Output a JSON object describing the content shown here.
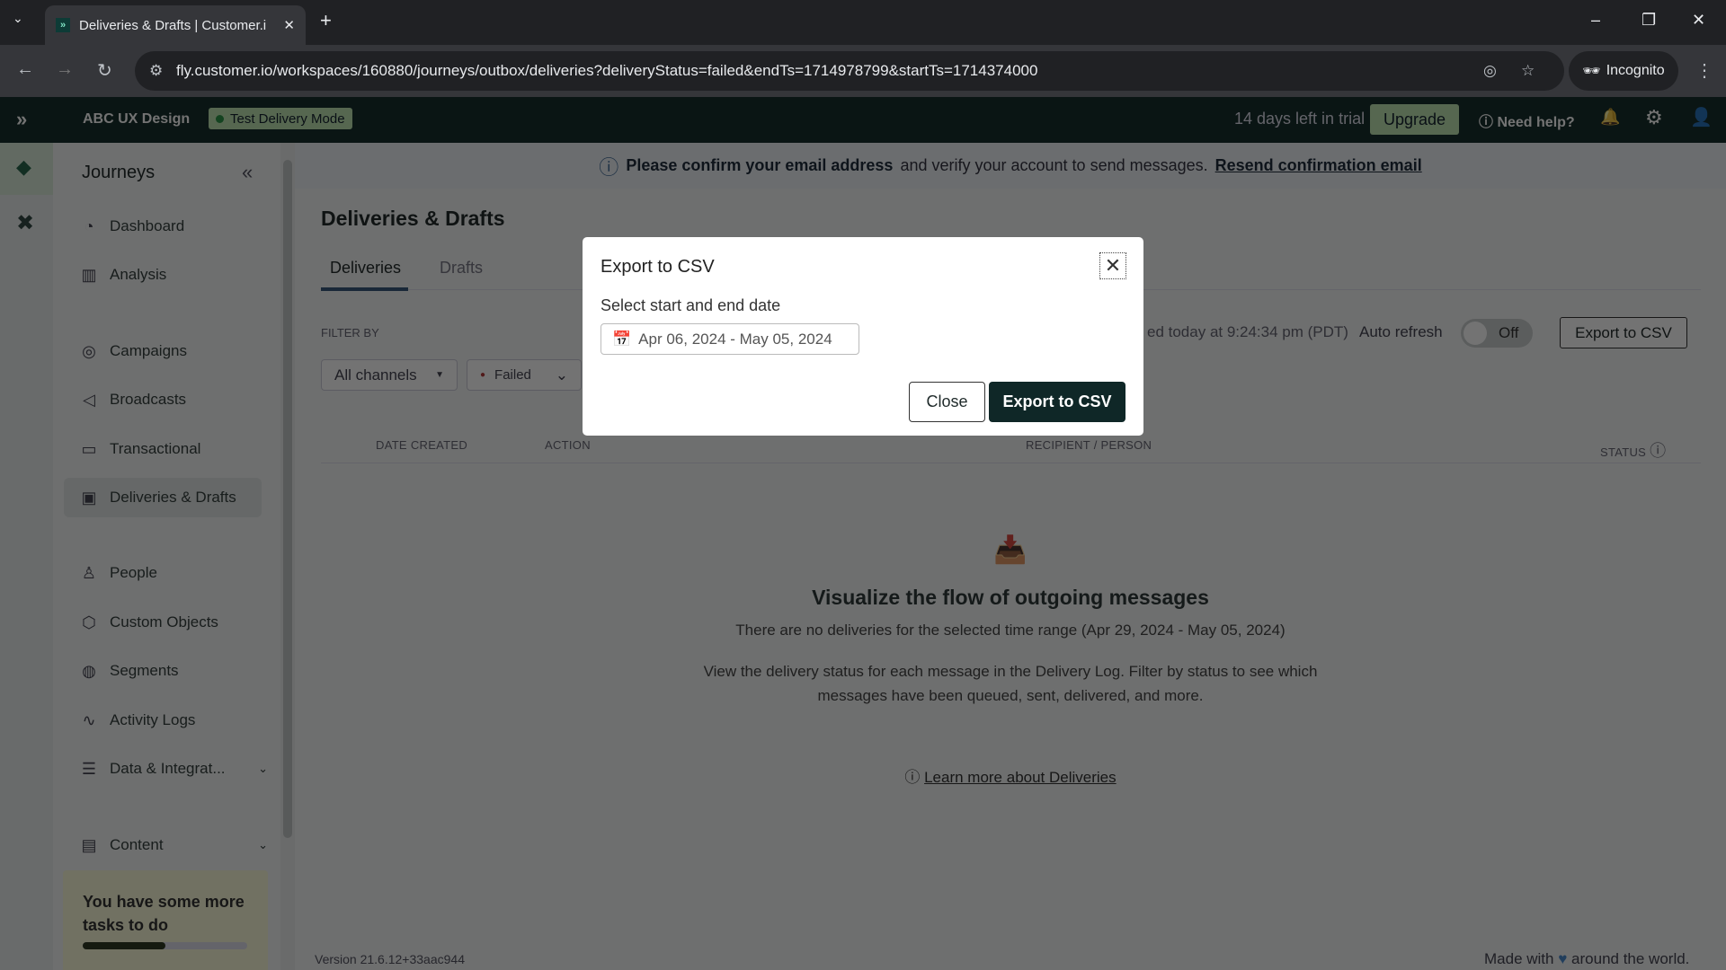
{
  "browser": {
    "tab_title": "Deliveries & Drafts | Customer.i",
    "url": "fly.customer.io/workspaces/160880/journeys/outbox/deliveries?deliveryStatus=failed&endTs=1714978799&startTs=1714374000",
    "incognito": "Incognito"
  },
  "header": {
    "workspace": "ABC UX Design",
    "mode_badge": "Test Delivery Mode",
    "trial": "14 days left in trial",
    "upgrade": "Upgrade",
    "help": "Need help?"
  },
  "sidebar": {
    "title": "Journeys",
    "items": [
      {
        "label": "Dashboard"
      },
      {
        "label": "Analysis"
      },
      {
        "label": "Campaigns"
      },
      {
        "label": "Broadcasts"
      },
      {
        "label": "Transactional"
      },
      {
        "label": "Deliveries & Drafts"
      },
      {
        "label": "People"
      },
      {
        "label": "Custom Objects"
      },
      {
        "label": "Segments"
      },
      {
        "label": "Activity Logs"
      },
      {
        "label": "Data & Integrat..."
      },
      {
        "label": "Content"
      }
    ],
    "tasks": {
      "title": "You have some more tasks to do",
      "progress": 0.5
    }
  },
  "banner": {
    "bold": "Please confirm your email address",
    "text": "and verify your account to send messages.",
    "link": "Resend confirmation email"
  },
  "main": {
    "title": "Deliveries & Drafts",
    "tabs": [
      {
        "label": "Deliveries"
      },
      {
        "label": "Drafts"
      }
    ],
    "filter_by": "FILTER BY",
    "channel_filter": "All channels",
    "status_filter": "Failed",
    "updated": "ed today at 9:24:34 pm (PDT)",
    "auto_refresh": "Auto refresh",
    "toggle": "Off",
    "export": "Export to CSV",
    "columns": [
      "DATE CREATED",
      "ACTION",
      "RECIPIENT / PERSON",
      "STATUS"
    ],
    "empty": {
      "title": "Visualize the flow of outgoing messages",
      "subtitle": "There are no deliveries for the selected time range (Apr 29, 2024 - May 05, 2024)",
      "para1": "View the delivery status for each message in the Delivery Log. Filter by status to see which",
      "para2": "messages have been queued, sent, delivered, and more.",
      "link": "Learn more about Deliveries"
    },
    "version": "Version 21.6.12+33aac944",
    "footer": "Made with",
    "footer2": "around the world."
  },
  "modal": {
    "title": "Export to CSV",
    "label": "Select start and end date",
    "date_range": "Apr 06, 2024 - May 05, 2024",
    "close": "Close",
    "export": "Export to CSV"
  }
}
